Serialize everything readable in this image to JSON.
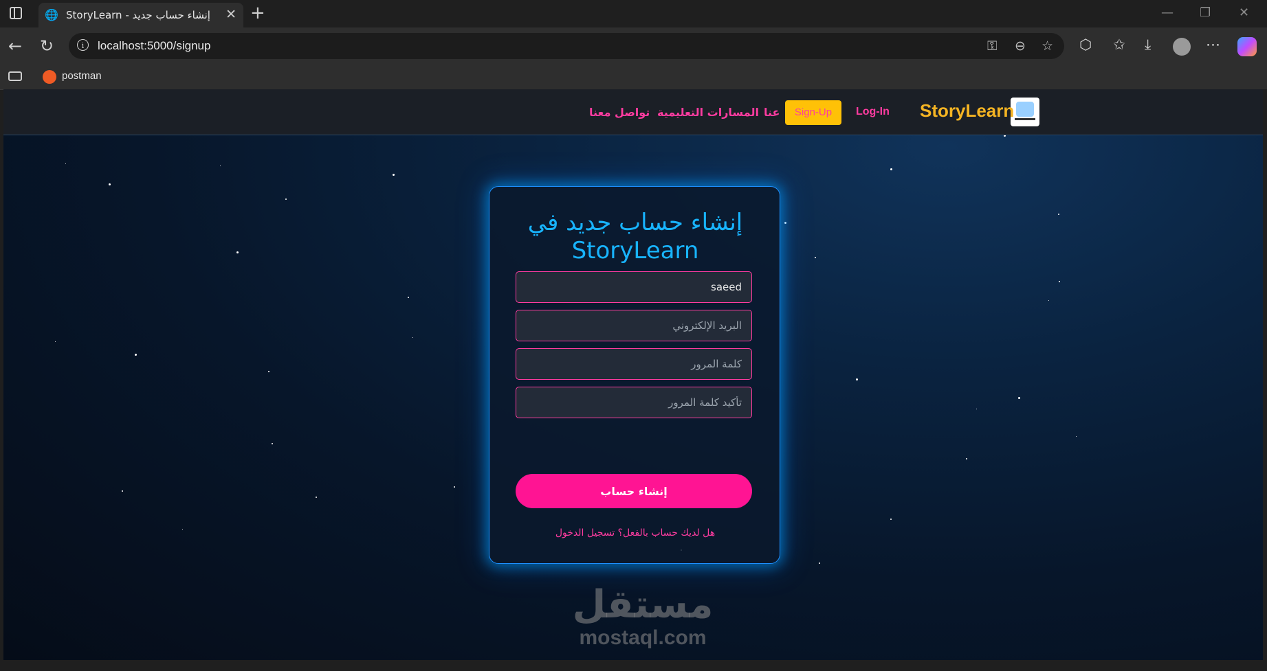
{
  "browser": {
    "tab_title": "StoryLearn - إنشاء حساب جديد",
    "url": "localhost:5000/signup",
    "bookmark_label": "postman",
    "new_tab_symbol": "+",
    "close_tab_symbol": "✕"
  },
  "header": {
    "brand": "StoryLearn",
    "nav": {
      "login": "Log-In",
      "signup": "Sign-Up",
      "about": "عنا",
      "paths": "المسارات التعليمية",
      "contact": "تواصل معنا"
    }
  },
  "form": {
    "title": "إنشاء حساب جديد في StoryLearn",
    "name_value": "saeed",
    "email_placeholder": "البريد الإلكتروني",
    "password_placeholder": "كلمة المرور",
    "confirm_placeholder": "تأكيد كلمة المرور",
    "submit_label": "إنشاء حساب",
    "login_prompt": "هل لديك حساب بالفعل؟ تسجيل الدخول"
  },
  "watermark": {
    "arabic": "مستقل",
    "latin": "mostaql.com"
  },
  "colors": {
    "accent_pink": "#ff1493",
    "brand_yellow": "#f5b423",
    "title_blue": "#18b4ff"
  }
}
